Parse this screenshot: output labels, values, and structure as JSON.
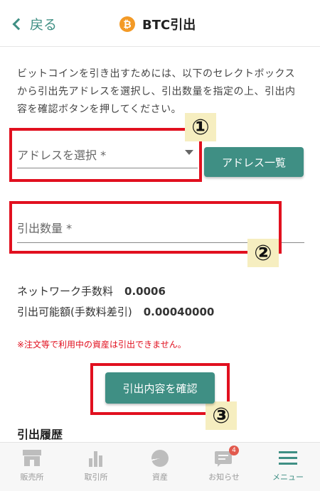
{
  "header": {
    "back_label": "戻る",
    "coin_symbol": "₿",
    "title": "BTC引出"
  },
  "description": "ビットコインを引き出すためには、以下のセレクトボックスから引出先アドレスを選択し、引出数量を指定の上、引出内容を確認ボタンを押してください。",
  "address_select": {
    "placeholder": "アドレスを選択 *"
  },
  "address_list_button": "アドレス一覧",
  "quantity_field": {
    "placeholder": "引出数量 *"
  },
  "annotations": {
    "step1": "①",
    "step2": "②",
    "step3": "③"
  },
  "fees": {
    "network_fee_label": "ネットワーク手数料",
    "network_fee_value": "0.0006",
    "available_label": "引出可能額(手数料差引)",
    "available_value": "0.00040000"
  },
  "warning": "※注文等で利用中の資産は引出できません。",
  "confirm_button": "引出内容を確認",
  "history_heading": "引出履歴",
  "tabbar": {
    "items": [
      {
        "label": "販売所",
        "icon": "shop-icon"
      },
      {
        "label": "取引所",
        "icon": "bar-chart-icon"
      },
      {
        "label": "資産",
        "icon": "pie-chart-icon"
      },
      {
        "label": "お知らせ",
        "icon": "message-icon",
        "badge": "4"
      },
      {
        "label": "メニュー",
        "icon": "menu-icon"
      }
    ]
  },
  "colors": {
    "accent": "#3f8f84",
    "annotation_red": "#e1101f",
    "btc_orange": "#f39a26",
    "badge_bg": "#f6eec0"
  }
}
